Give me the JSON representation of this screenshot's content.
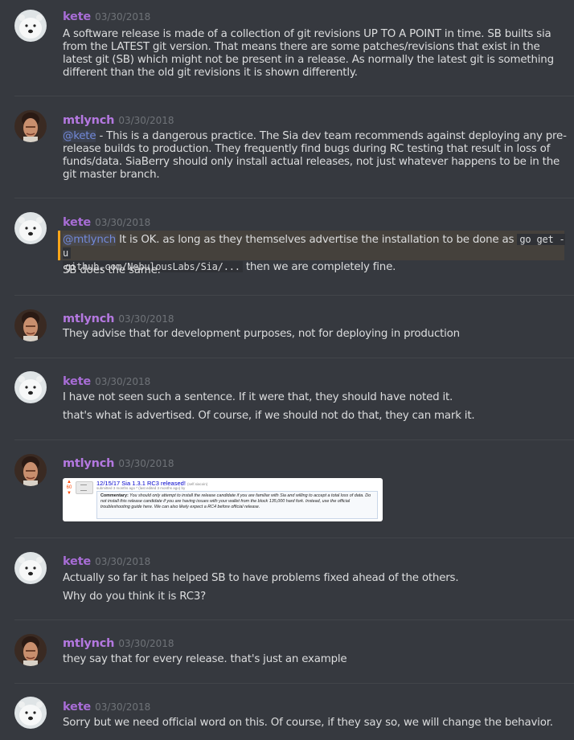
{
  "colors": {
    "background": "#36393f",
    "author_name": "#a86dd6",
    "timestamp": "#6f7378",
    "text": "#dcddde",
    "mention": "#7289da",
    "highlight_border": "#faa61a"
  },
  "messages": [
    {
      "author": "kete",
      "timestamp": "03/30/2018",
      "avatar": "polar-bear-avatar",
      "lines": [
        "A software release is made of a collection of git revisions UP TO A POINT in time. SB builts sia from the LATEST git version. That means there are some patches/revisions that exist in the latest git (SB) which might not be present in a release. As normally the latest git is something different than the old git revisions it is shown differently."
      ]
    },
    {
      "author": "mtlynch",
      "timestamp": "03/30/2018",
      "avatar": "person-avatar",
      "mention": "@kete",
      "text": " - This is a dangerous practice. The Sia dev team recommends against deploying any pre-release builds to production. They frequently find bugs during RC testing that result in loss of funds/data. SiaBerry should only install actual releases, not just whatever happens to be in the git master branch."
    },
    {
      "author": "kete",
      "timestamp": "03/30/2018",
      "avatar": "polar-bear-avatar",
      "mention": "@mtlynch",
      "text_before_code": " It is OK. as long as they themselves advertise the installation to be done as ",
      "code_part1": "go get -u",
      "code_part2": "github.com/NebulousLabs/Sia/...",
      "text_after_code": " then we are completely fine.",
      "line2": "SB does the same."
    },
    {
      "author": "mtlynch",
      "timestamp": "03/30/2018",
      "avatar": "person-avatar",
      "text": "They advise that for development purposes, not for deploying in production"
    },
    {
      "author": "kete",
      "timestamp": "03/30/2018",
      "avatar": "polar-bear-avatar",
      "line1": "I have not seen such a sentence. If it were that, they should have noted it.",
      "line2": "that's what is advertised. Of course, if we should not do that, they can mark it."
    },
    {
      "author": "mtlynch",
      "timestamp": "03/30/2018",
      "avatar": "person-avatar",
      "embed": {
        "score": "60",
        "title": "12/15/17 Sia 1.3.1 RC3 released!",
        "tag": "(self.siacoin)",
        "meta": "submitted 3 months ago * (last edited 3 months ago) by",
        "commentary_label": "Commentary:",
        "commentary": " You should only attempt to install the release candidate if you are familiar with Sia and willing to accept a total loss of data. Do not install this release candidate if you are having issues with your wallet from the block 135,000 hard fork. Instead, use the official troubleshooting guide here. We can also likely expect a RC4 before official release."
      }
    },
    {
      "author": "kete",
      "timestamp": "03/30/2018",
      "avatar": "polar-bear-avatar",
      "line1": "Actually so far it has helped SB to have problems fixed ahead of the others.",
      "line2": "Why do you think it is RC3?"
    },
    {
      "author": "mtlynch",
      "timestamp": "03/30/2018",
      "avatar": "person-avatar",
      "text": "they say that for every release. that's just an example"
    },
    {
      "author": "kete",
      "timestamp": "03/30/2018",
      "avatar": "polar-bear-avatar",
      "text": "Sorry but we need official word on this. Of course, if they say so, we will change the behavior."
    }
  ]
}
